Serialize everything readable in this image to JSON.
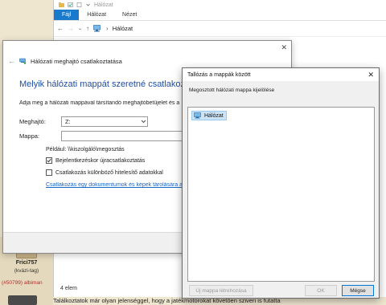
{
  "explorer": {
    "title": "Hálózat",
    "ribbon_tabs": [
      "Fájl",
      "Hálózat",
      "Nézet"
    ],
    "address": "Hálózat",
    "status": "4 elem"
  },
  "wizard": {
    "title": "Hálózati meghajtó csatlakoztatása",
    "heading": "Melyik hálózati mappát szeretné csatlakoztatni?",
    "description": "Adja meg a hálózati mappával társítandó meghajtóbetűjelet és a",
    "drive_label": "Meghajtó:",
    "drive_value": "Z:",
    "folder_label": "Mappa:",
    "folder_value": "",
    "example": "Például: \\\\kiszolgáló\\megosztás",
    "reconnect_label": "Bejelentkezéskor újracsatlakoztatás",
    "reconnect_checked": true,
    "credentials_label": "Csatlakozás különböző hitelesítő adatokkal",
    "credentials_checked": false,
    "link": "Csatlakozás egy dokumentumok és képek tárolására al"
  },
  "browse": {
    "title": "Tallózás a mappák között",
    "prompt": "Megosztott hálózati mappa kijelölése",
    "tree_items": [
      "Hálózat"
    ],
    "new_folder_button": "Új mappa létrehozása",
    "ok_button": "OK",
    "cancel_button": "Mégse"
  },
  "forum": {
    "username": "Frici757",
    "user_tag": "(kvázi-tag)",
    "post_id": "(#50799) albiman",
    "post_text": "Találkoztatok már olyan jelenséggel, hogy a jatékmotorokat követően sziveri is futatta"
  },
  "colors": {
    "accent": "#1979ca",
    "heading": "#1d4ea8",
    "link": "#1a66c8",
    "selection": "#cce4f7"
  }
}
